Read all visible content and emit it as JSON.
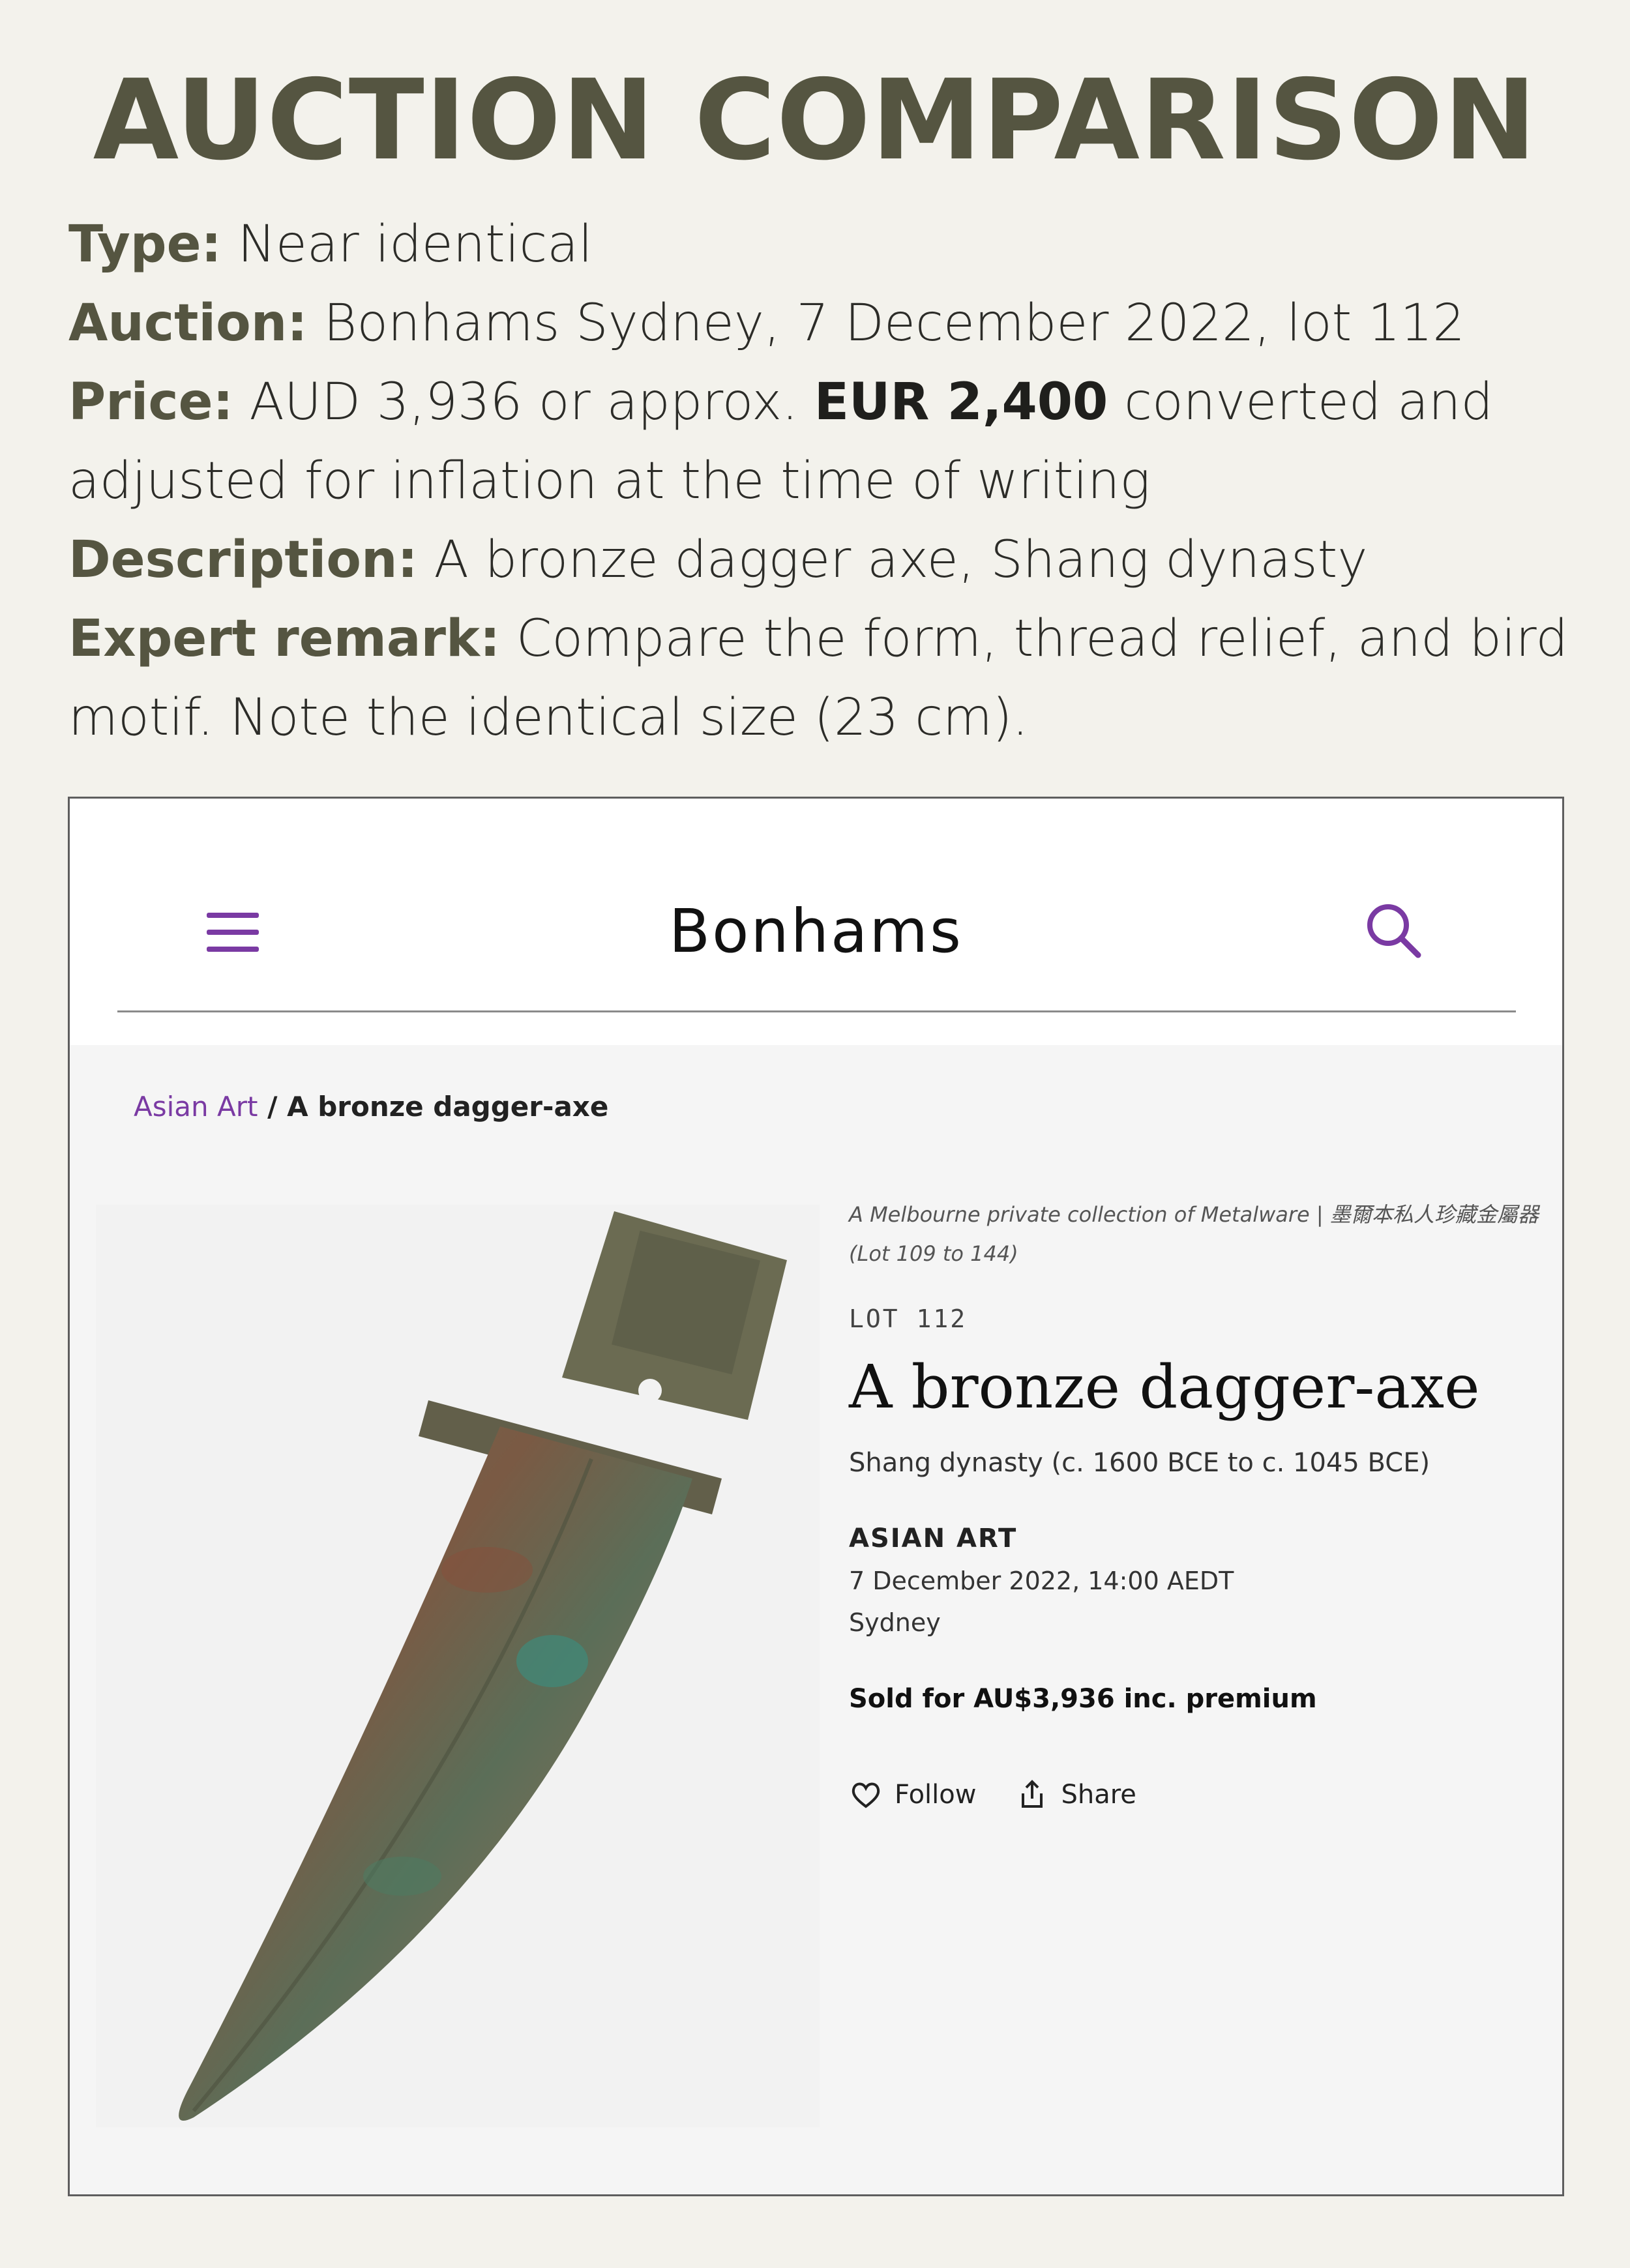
{
  "heading": "AUCTION COMPARISON",
  "info": {
    "type_label": "Type:",
    "type_value": "Near identical",
    "auction_label": "Auction:",
    "auction_value": "Bonhams Sydney, 7 December 2022, lot 112",
    "price_label": "Price:",
    "price_pre": "AUD 3,936 or approx.",
    "price_bold": "EUR 2,400",
    "price_post": "converted and adjusted for inflation at the time of writing",
    "description_label": "Description:",
    "description_value": "A bronze dagger axe, Shang dynasty",
    "remark_label": "Expert remark:",
    "remark_value": "Compare the form, thread relief, and bird motif. Note the identical size (23 cm)."
  },
  "site": {
    "brand": "Bonhams",
    "menu_icon": "hamburger-menu-icon",
    "search_icon": "search-icon",
    "accent": "#7a3aa3"
  },
  "breadcrumb": {
    "parent": "Asian Art",
    "separator": "/",
    "current": "A bronze dagger-axe"
  },
  "lot": {
    "collection": "A Melbourne private collection of Metalware | 墨爾本私人珍藏金屬器 (Lot 109 to 144)",
    "lot_number": "LOT 112",
    "title": "A bronze dagger-axe",
    "dynasty": "Shang dynasty (c. 1600 BCE to c. 1045 BCE)",
    "sale_name": "ASIAN ART",
    "date": "7 December 2022, 14:00 AEDT",
    "city": "Sydney",
    "sold": "Sold for AU$3,936 inc. premium",
    "follow_label": "Follow",
    "share_label": "Share"
  }
}
